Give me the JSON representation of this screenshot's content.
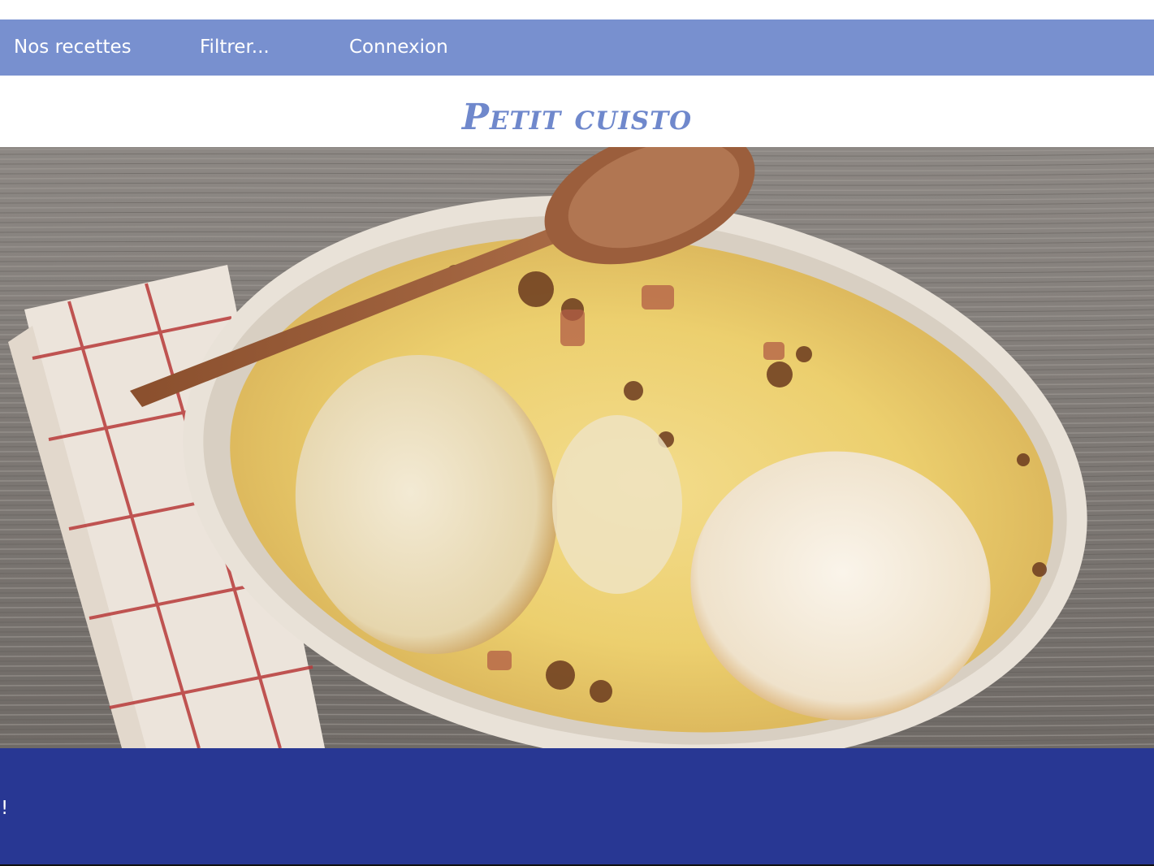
{
  "nav": {
    "items": [
      {
        "label": "Nos recettes"
      },
      {
        "label": "Filtrer..."
      },
      {
        "label": "Connexion"
      }
    ],
    "background": "#7890cf"
  },
  "header": {
    "title": "Petit cuisto",
    "title_color": "#6f88cc"
  },
  "hero": {
    "image": "casserole-gratin-photo"
  },
  "footer": {
    "text": "!",
    "background": "#283793"
  }
}
